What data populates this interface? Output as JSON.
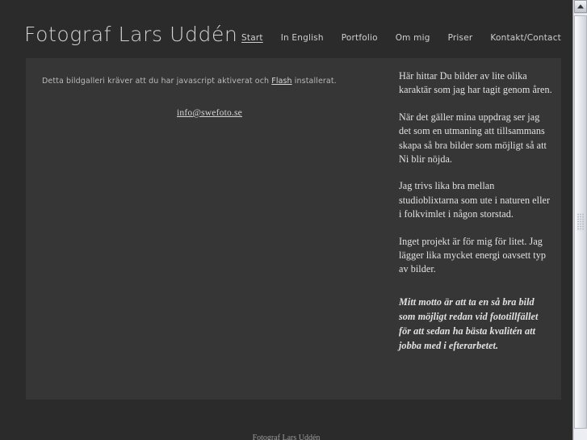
{
  "header": {
    "site_title": "Fotograf Lars Uddén",
    "nav": [
      {
        "label": "Start",
        "active": true
      },
      {
        "label": "In English",
        "active": false
      },
      {
        "label": "Portfolio",
        "active": false
      },
      {
        "label": "Om mig",
        "active": false
      },
      {
        "label": "Priser",
        "active": false
      },
      {
        "label": "Kontakt/Contact",
        "active": false
      }
    ]
  },
  "gallery": {
    "notice_before": "Detta bildgalleri kräver att du har javascript aktiverat och ",
    "notice_link": "Flash",
    "notice_after": " installerat.",
    "email": "info@swefoto.se"
  },
  "about": {
    "paragraphs": [
      "Här hittar Du bilder av lite olika karaktär som jag har tagit genom åren.",
      "När det gäller mina uppdrag ser jag det som en utmaning att tillsammans skapa så bra bilder som möjligt så att Ni blir nöjda.",
      "Jag trivs lika bra mellan studioblixtarna som ute i naturen eller i folkvimlet i någon storstad.",
      "Inget projekt är för mig för litet. Jag lägger lika mycket energi oavsett typ av bilder."
    ],
    "motto": "Mitt motto är att ta en så bra bild som möjligt redan vid fototillfället för att sedan ha bästa kvalitén att jobba med i efterarbetet."
  },
  "footer": {
    "text": "Fotograf Lars Uddén"
  },
  "colors": {
    "page_background": "#2b2b2b",
    "panel_background": "#363636",
    "title_text": "#d2d2d2",
    "body_text": "#e2e2e2",
    "notice_text": "#b9b9b9"
  },
  "scrollbar": {
    "up_arrow": "scroll-up-arrow"
  }
}
